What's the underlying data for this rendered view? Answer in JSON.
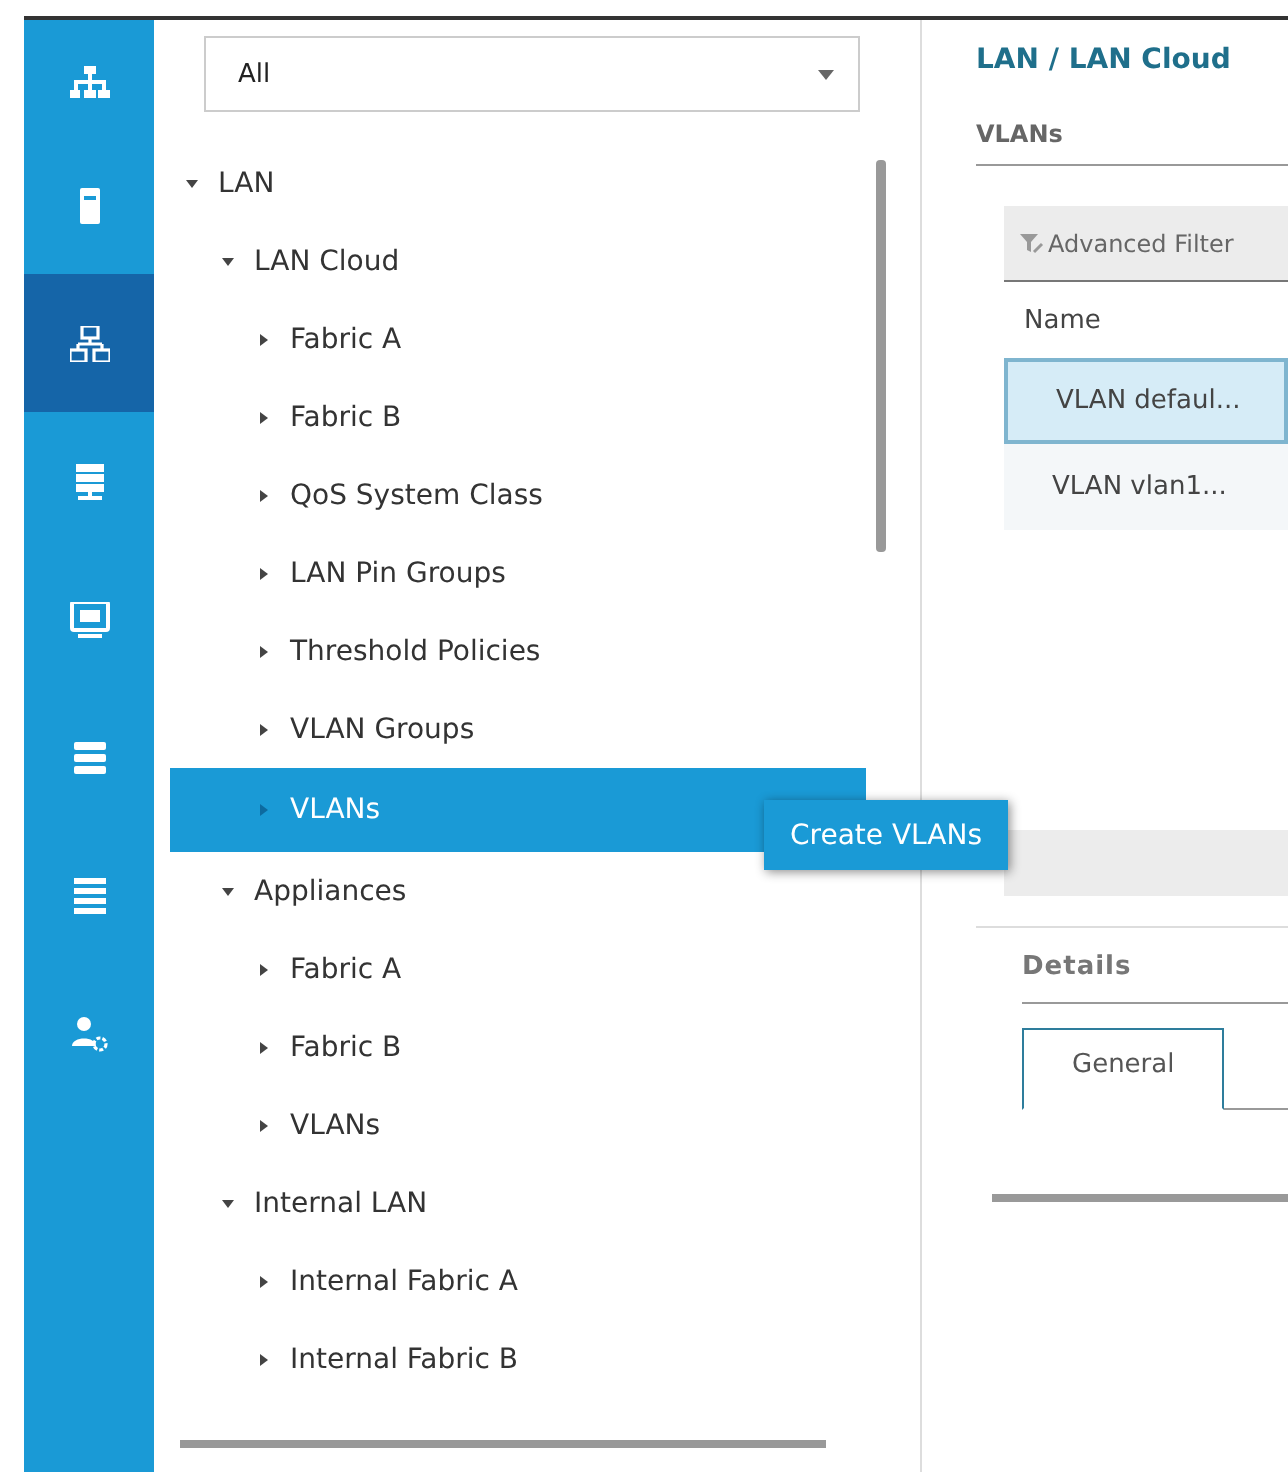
{
  "rail": {
    "items": [
      {
        "selected": false
      },
      {
        "selected": false
      },
      {
        "selected": true
      },
      {
        "selected": false
      },
      {
        "selected": false
      },
      {
        "selected": false
      },
      {
        "selected": false
      },
      {
        "selected": false
      }
    ]
  },
  "filter": {
    "value": "All"
  },
  "tree": [
    {
      "label": "LAN",
      "expanded": true,
      "selected": false,
      "children": [
        {
          "label": "LAN Cloud",
          "expanded": true,
          "selected": false,
          "children": [
            {
              "label": "Fabric A",
              "expanded": false,
              "selected": false
            },
            {
              "label": "Fabric B",
              "expanded": false,
              "selected": false
            },
            {
              "label": "QoS System Class",
              "expanded": false,
              "selected": false
            },
            {
              "label": "LAN Pin Groups",
              "expanded": false,
              "selected": false
            },
            {
              "label": "Threshold Policies",
              "expanded": false,
              "selected": false
            },
            {
              "label": "VLAN Groups",
              "expanded": false,
              "selected": false
            },
            {
              "label": "VLANs",
              "expanded": false,
              "selected": true
            }
          ]
        },
        {
          "label": "Appliances",
          "expanded": true,
          "selected": false,
          "children": [
            {
              "label": "Fabric A",
              "expanded": false,
              "selected": false
            },
            {
              "label": "Fabric B",
              "expanded": false,
              "selected": false
            },
            {
              "label": "VLANs",
              "expanded": false,
              "selected": false
            }
          ]
        },
        {
          "label": "Internal LAN",
          "expanded": true,
          "selected": false,
          "children": [
            {
              "label": "Internal Fabric A",
              "expanded": false,
              "selected": false
            },
            {
              "label": "Internal Fabric B",
              "expanded": false,
              "selected": false
            }
          ]
        }
      ]
    }
  ],
  "context_menu": {
    "items": [
      "Create VLANs"
    ]
  },
  "breadcrumb": "LAN / LAN Cloud",
  "section_title": "VLANs",
  "table": {
    "toolbar": "Advanced Filter",
    "columns": [
      "Name"
    ],
    "rows": [
      {
        "name": "VLAN defaul...",
        "selected": true
      },
      {
        "name": "VLAN vlan1...",
        "selected": false
      }
    ]
  },
  "details": {
    "title": "Details",
    "tabs": [
      {
        "label": "General",
        "selected": true
      }
    ]
  }
}
